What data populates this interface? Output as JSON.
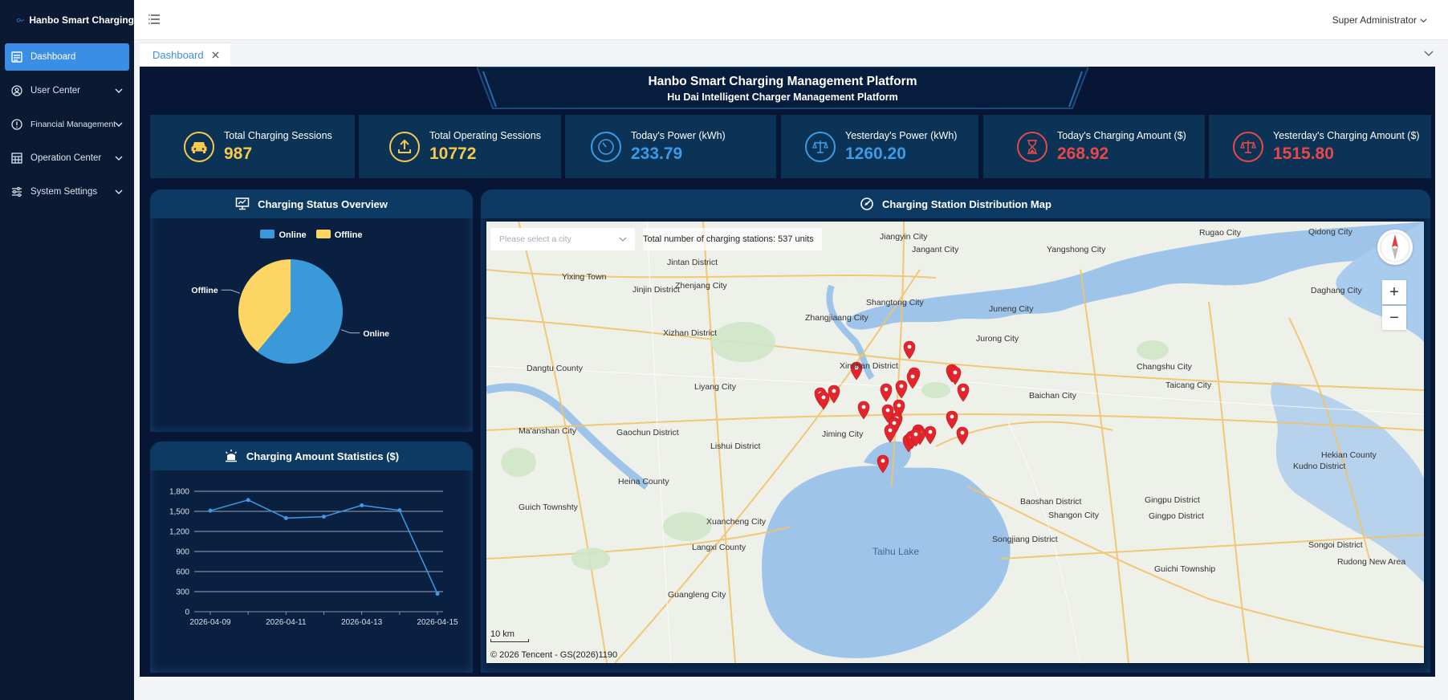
{
  "brand": {
    "name": "Hanbo Smart Charging"
  },
  "sidebar": {
    "items": [
      {
        "label": "Dashboard",
        "icon": "dashboard-icon",
        "active": true
      },
      {
        "label": "User Center",
        "icon": "user-center-icon"
      },
      {
        "label": "Financial Management",
        "icon": "financial-icon"
      },
      {
        "label": "Operation Center",
        "icon": "grid-icon"
      },
      {
        "label": "System Settings",
        "icon": "sliders-icon"
      }
    ]
  },
  "header": {
    "user": "Super Administrator"
  },
  "tabs": [
    {
      "label": "Dashboard"
    }
  ],
  "dashboard": {
    "title": "Hanbo Smart Charging Management Platform",
    "subtitle": "Hu Dai Intelligent Charger Management Platform",
    "stats": [
      {
        "label": "Total Charging Sessions",
        "value": "987",
        "color": "#f6c84c",
        "icon": "car-icon"
      },
      {
        "label": "Total Operating Sessions",
        "value": "10772",
        "color": "#f6c84c",
        "icon": "upload-icon"
      },
      {
        "label": "Today's Power (kWh)",
        "value": "233.79",
        "color": "#3c9ae6",
        "icon": "gauge-icon"
      },
      {
        "label": "Yesterday's Power (kWh)",
        "value": "1260.20",
        "color": "#3c9ae6",
        "icon": "scale-icon"
      },
      {
        "label": "Today's Charging Amount ($)",
        "value": "268.92",
        "color": "#e9474a",
        "icon": "hourglass-icon"
      },
      {
        "label": "Yesterday's Charging Amount ($)",
        "value": "1515.80",
        "color": "#e9474a",
        "icon": "scale-icon"
      }
    ]
  },
  "status_panel": {
    "title": "Charging Status Overview"
  },
  "amount_panel": {
    "title": "Charging Amount Statistics ($)"
  },
  "map_panel": {
    "title": "Charging Station Distribution Map",
    "select_placeholder": "Please select a city",
    "total_text": "Total number of charging stations: 537 units",
    "scale": "10 km",
    "copyright": "© 2026 Tencent - GS(2026)1190",
    "zoom_in": "+",
    "zoom_out": "−",
    "labels": [
      "Jiangyin City",
      "Jangant City",
      "Yangshong City",
      "Rugao City",
      "Qidong City",
      "Jintan District",
      "Yixing Town",
      "Zhenjang City",
      "Jinjin District",
      "Daghang City",
      "Shangtong City",
      "Juneng City",
      "Zhangjiaang City",
      "Xizhan District",
      "Jurong City",
      "Dangtu County",
      "Xinshan District",
      "Changshu City",
      "Liyang City",
      "Taicang City",
      "Baichan City",
      "Ma'anshan City",
      "Gaochun District",
      "Jiming City",
      "Lishui District",
      "Hekian County",
      "Kudno District",
      "Heina County",
      "Guich Townshty",
      "Xuancheng City",
      "Baoshan District",
      "Shangon City",
      "Gingpo District",
      "Gingpu District",
      "Taihu Lake",
      "Langxi County",
      "Songjiang District",
      "Songoi District",
      "Rudong New Area",
      "Guichi Township",
      "Guangleng City"
    ]
  },
  "chart_data": [
    {
      "type": "pie",
      "title": "Charging Status Overview",
      "legend": [
        "Online",
        "Offline"
      ],
      "slices": [
        {
          "name": "Online",
          "value": 61,
          "color": "#3a9ad9"
        },
        {
          "name": "Offline",
          "value": 39,
          "color": "#fdd565"
        }
      ]
    },
    {
      "type": "line",
      "title": "Charging Amount Statistics ($)",
      "x": [
        "2026-04-09",
        "2026-04-10",
        "2026-04-11",
        "2026-04-12",
        "2026-04-13",
        "2026-04-14",
        "2026-04-15"
      ],
      "x_tick_labels": [
        "2026-04-09",
        "2026-04-11",
        "2026-04-13",
        "2026-04-15"
      ],
      "series": [
        {
          "values": [
            1510,
            1670,
            1400,
            1420,
            1590,
            1516,
            269
          ],
          "color": "#3c9ae6"
        }
      ],
      "ylim": [
        0,
        1800
      ],
      "yticks": [
        0,
        300,
        600,
        900,
        1200,
        1500,
        1800
      ],
      "ytick_labels": [
        "0",
        "300",
        "600",
        "900",
        "1,200",
        "1,500",
        "1,800"
      ],
      "grid": true
    }
  ]
}
